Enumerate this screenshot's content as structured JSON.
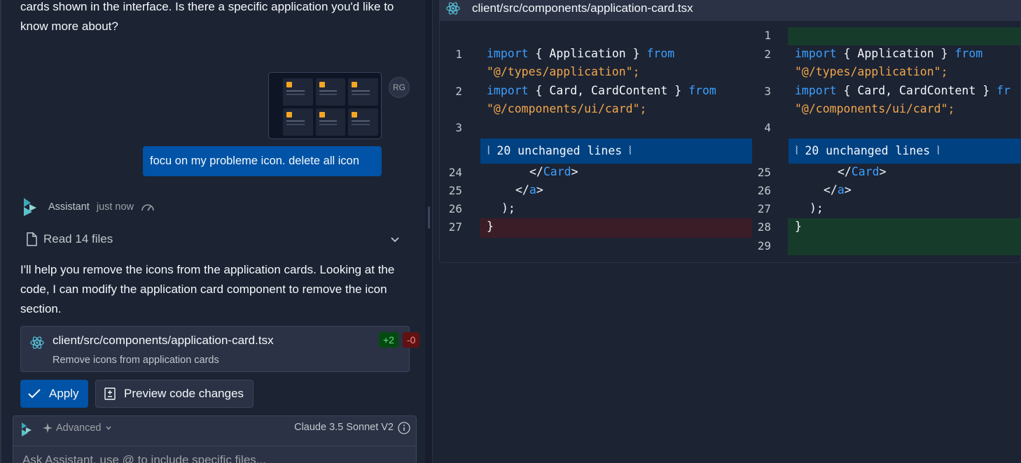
{
  "chat": {
    "intro_text": "cards shown in the interface. Is there a specific application you'd like to know more about?",
    "avatar_initials": "RG",
    "user_message": "focu on my probleme icon. delete all icon",
    "assistant_name": "Assistant",
    "assistant_time": "just now",
    "read_files_label": "Read 14 files",
    "explanation": "I'll help you remove the icons from the application cards. Looking at the code, I can modify the application card component to remove the icon section.",
    "file_card": {
      "filename": "client/src/components/application-card.tsx",
      "description": "Remove icons from application cards",
      "additions": "+2",
      "deletions": "-0"
    },
    "apply_label": "Apply",
    "preview_label": "Preview code changes",
    "composer": {
      "mode_label": "Advanced",
      "model_label": "Claude 3.5 Sonnet V2",
      "placeholder": "Ask Assistant, use @ to include specific files..."
    }
  },
  "diff": {
    "file_path": "client/src/components/application-card.tsx",
    "left": {
      "line_numbers": [
        "1",
        "2",
        "3",
        "24",
        "25",
        "26",
        "27"
      ],
      "unchanged_label": "⦚ 20 unchanged lines ⦚"
    },
    "right": {
      "line_numbers": [
        "1",
        "2",
        "3",
        "4",
        "25",
        "26",
        "27",
        "28",
        "29"
      ],
      "unchanged_label": "⦚ 20 unchanged lines ⦚"
    },
    "tokens": {
      "import": "import",
      "from": "from",
      "app_import": "{ Application }",
      "app_path": "\"@/types/application\";",
      "card_import": "{ Card, CardContent }",
      "card_path": "\"@/components/ui/card\";",
      "close_card_open": "</",
      "card_tag": "Card",
      "a_tag": "a",
      "close_bracket": ">",
      "paren_close": ");",
      "brace_close": "}",
      "fr": "fr"
    }
  },
  "colors": {
    "background": "#1c2333",
    "accent": "#0053a6",
    "keyword": "#3ca0ff",
    "string": "#f2a74b",
    "added_bg": "#173b2b",
    "removed_bg": "#3a1d27"
  }
}
